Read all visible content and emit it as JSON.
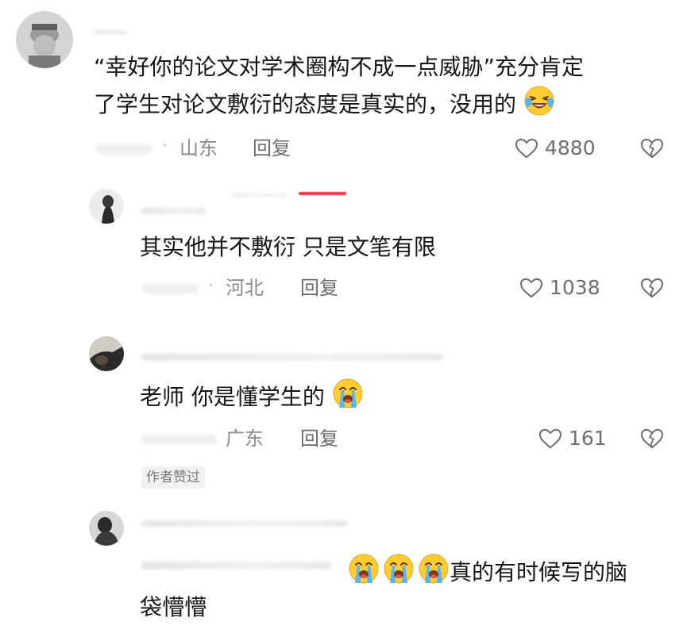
{
  "comments": [
    {
      "text_line1": "“幸好你的论文对学术圈构不成一点威胁”充分肯定",
      "text_line2": "了学生对论文敷衍的态度是真实的，没用的",
      "location": "山东",
      "reply_label": "回复",
      "likes": "4880"
    },
    {
      "text": "其实他并不敷衍 只是文笔有限",
      "location": "河北",
      "reply_label": "回复",
      "likes": "1038"
    },
    {
      "text": "老师 你是懂学生的",
      "location": "广东",
      "reply_label": "回复",
      "likes": "161",
      "badge": "作者赞过"
    },
    {
      "text_line1": "真的有时候写的脑",
      "text_line2": "袋懵懵"
    }
  ],
  "icons": {
    "like": "heart-outline-icon",
    "dislike": "broken-heart-icon",
    "emoji_laugh": "laughing-tears-emoji",
    "emoji_cry": "loudly-crying-emoji"
  },
  "colors": {
    "emoji_face": "#ffcc33",
    "emoji_tear": "#5ab4f0",
    "accent_red": "#ff2a4a"
  }
}
